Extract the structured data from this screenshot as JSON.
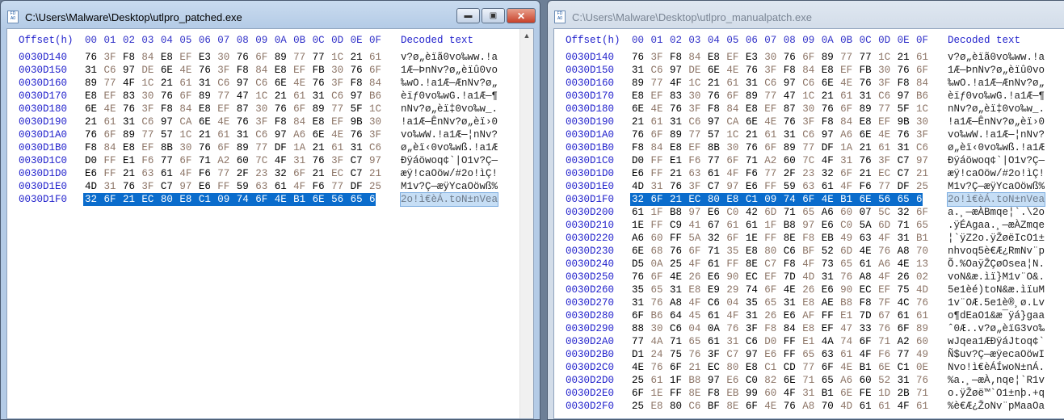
{
  "header": {
    "offset_label": "Offset(h)",
    "columns": [
      "00",
      "01",
      "02",
      "03",
      "04",
      "05",
      "06",
      "07",
      "08",
      "09",
      "0A",
      "0B",
      "0C",
      "0D",
      "0E",
      "0F"
    ],
    "decoded_label": "Decoded text"
  },
  "windows": [
    {
      "title": "C:\\Users\\Malware\\Desktop\\utlpro_patched.exe",
      "active": true,
      "selected_offset": "0030D1F0",
      "rows": [
        {
          "offset": "0030D140",
          "hex": [
            "76",
            "3F",
            "F8",
            "84",
            "E8",
            "EF",
            "E3",
            "30",
            "76",
            "6F",
            "89",
            "77",
            "77",
            "1C",
            "21",
            "61"
          ],
          "text": "v?ø„èïã0vo‰ww.!a"
        },
        {
          "offset": "0030D150",
          "hex": [
            "31",
            "C6",
            "97",
            "DE",
            "6E",
            "4E",
            "76",
            "3F",
            "F8",
            "84",
            "E8",
            "EF",
            "FB",
            "30",
            "76",
            "6F"
          ],
          "text": "1Æ—ÞnNv?ø„èïû0vo"
        },
        {
          "offset": "0030D160",
          "hex": [
            "89",
            "77",
            "4F",
            "1C",
            "21",
            "61",
            "31",
            "C6",
            "97",
            "C6",
            "6E",
            "4E",
            "76",
            "3F",
            "F8",
            "84"
          ],
          "text": "‰wO.!a1Æ—ÆnNv?ø„"
        },
        {
          "offset": "0030D170",
          "hex": [
            "E8",
            "EF",
            "83",
            "30",
            "76",
            "6F",
            "89",
            "77",
            "47",
            "1C",
            "21",
            "61",
            "31",
            "C6",
            "97",
            "B6"
          ],
          "text": "èïƒ0vo‰wG.!a1Æ—¶"
        },
        {
          "offset": "0030D180",
          "hex": [
            "6E",
            "4E",
            "76",
            "3F",
            "F8",
            "84",
            "E8",
            "EF",
            "87",
            "30",
            "76",
            "6F",
            "89",
            "77",
            "5F",
            "1C"
          ],
          "text": "nNv?ø„èï‡0vo‰w_."
        },
        {
          "offset": "0030D190",
          "hex": [
            "21",
            "61",
            "31",
            "C6",
            "97",
            "CA",
            "6E",
            "4E",
            "76",
            "3F",
            "F8",
            "84",
            "E8",
            "EF",
            "9B",
            "30"
          ],
          "text": "!a1Æ—ÊnNv?ø„èï›0"
        },
        {
          "offset": "0030D1A0",
          "hex": [
            "76",
            "6F",
            "89",
            "77",
            "57",
            "1C",
            "21",
            "61",
            "31",
            "C6",
            "97",
            "A6",
            "6E",
            "4E",
            "76",
            "3F"
          ],
          "text": "vo‰wW.!a1Æ—¦nNv?"
        },
        {
          "offset": "0030D1B0",
          "hex": [
            "F8",
            "84",
            "E8",
            "EF",
            "8B",
            "30",
            "76",
            "6F",
            "89",
            "77",
            "DF",
            "1A",
            "21",
            "61",
            "31",
            "C6"
          ],
          "text": "ø„èï‹0vo‰wß.!a1Æ"
        },
        {
          "offset": "0030D1C0",
          "hex": [
            "D0",
            "FF",
            "E1",
            "F6",
            "77",
            "6F",
            "71",
            "A2",
            "60",
            "7C",
            "4F",
            "31",
            "76",
            "3F",
            "C7",
            "97"
          ],
          "text": "Ðÿáöwoq¢`|O1v?Ç—"
        },
        {
          "offset": "0030D1D0",
          "hex": [
            "E6",
            "FF",
            "21",
            "63",
            "61",
            "4F",
            "F6",
            "77",
            "2F",
            "23",
            "32",
            "6F",
            "21",
            "EC",
            "C7",
            "21"
          ],
          "text": "æÿ!caOöw/#2o!ìÇ!"
        },
        {
          "offset": "0030D1E0",
          "hex": [
            "4D",
            "31",
            "76",
            "3F",
            "C7",
            "97",
            "E6",
            "FF",
            "59",
            "63",
            "61",
            "4F",
            "F6",
            "77",
            "DF",
            "25"
          ],
          "text": "M1v?Ç—æÿYcaOöwß%"
        },
        {
          "offset": "0030D1F0",
          "hex": [
            "32",
            "6F",
            "21",
            "EC",
            "80",
            "E8",
            "C1",
            "09",
            "74",
            "6F",
            "4E",
            "B1",
            "6E",
            "56",
            "65",
            "61"
          ],
          "text": "2o!ì€èÁ.toN±nVea"
        }
      ]
    },
    {
      "title": "C:\\Users\\Malware\\Desktop\\utlpro_manualpatch.exe",
      "active": false,
      "selected_offset": "0030D1F0",
      "rows": [
        {
          "offset": "0030D140",
          "hex": [
            "76",
            "3F",
            "F8",
            "84",
            "E8",
            "EF",
            "E3",
            "30",
            "76",
            "6F",
            "89",
            "77",
            "77",
            "1C",
            "21",
            "61"
          ],
          "text": "v?ø„èïã0vo‰ww.!a"
        },
        {
          "offset": "0030D150",
          "hex": [
            "31",
            "C6",
            "97",
            "DE",
            "6E",
            "4E",
            "76",
            "3F",
            "F8",
            "84",
            "E8",
            "EF",
            "FB",
            "30",
            "76",
            "6F"
          ],
          "text": "1Æ—ÞnNv?ø„èïû0vo"
        },
        {
          "offset": "0030D160",
          "hex": [
            "89",
            "77",
            "4F",
            "1C",
            "21",
            "61",
            "31",
            "C6",
            "97",
            "C6",
            "6E",
            "4E",
            "76",
            "3F",
            "F8",
            "84"
          ],
          "text": "‰wO.!a1Æ—ÆnNv?ø„"
        },
        {
          "offset": "0030D170",
          "hex": [
            "E8",
            "EF",
            "83",
            "30",
            "76",
            "6F",
            "89",
            "77",
            "47",
            "1C",
            "21",
            "61",
            "31",
            "C6",
            "97",
            "B6"
          ],
          "text": "èïƒ0vo‰wG.!a1Æ—¶"
        },
        {
          "offset": "0030D180",
          "hex": [
            "6E",
            "4E",
            "76",
            "3F",
            "F8",
            "84",
            "E8",
            "EF",
            "87",
            "30",
            "76",
            "6F",
            "89",
            "77",
            "5F",
            "1C"
          ],
          "text": "nNv?ø„èï‡0vo‰w_."
        },
        {
          "offset": "0030D190",
          "hex": [
            "21",
            "61",
            "31",
            "C6",
            "97",
            "CA",
            "6E",
            "4E",
            "76",
            "3F",
            "F8",
            "84",
            "E8",
            "EF",
            "9B",
            "30"
          ],
          "text": "!a1Æ—ÊnNv?ø„èï›0"
        },
        {
          "offset": "0030D1A0",
          "hex": [
            "76",
            "6F",
            "89",
            "77",
            "57",
            "1C",
            "21",
            "61",
            "31",
            "C6",
            "97",
            "A6",
            "6E",
            "4E",
            "76",
            "3F"
          ],
          "text": "vo‰wW.!a1Æ—¦nNv?"
        },
        {
          "offset": "0030D1B0",
          "hex": [
            "F8",
            "84",
            "E8",
            "EF",
            "8B",
            "30",
            "76",
            "6F",
            "89",
            "77",
            "DF",
            "1A",
            "21",
            "61",
            "31",
            "C6"
          ],
          "text": "ø„èï‹0vo‰wß.!a1Æ"
        },
        {
          "offset": "0030D1C0",
          "hex": [
            "D0",
            "FF",
            "E1",
            "F6",
            "77",
            "6F",
            "71",
            "A2",
            "60",
            "7C",
            "4F",
            "31",
            "76",
            "3F",
            "C7",
            "97"
          ],
          "text": "Ðÿáöwoq¢`|O1v?Ç—"
        },
        {
          "offset": "0030D1D0",
          "hex": [
            "E6",
            "FF",
            "21",
            "63",
            "61",
            "4F",
            "F6",
            "77",
            "2F",
            "23",
            "32",
            "6F",
            "21",
            "EC",
            "C7",
            "21"
          ],
          "text": "æÿ!caOöw/#2o!ìÇ!"
        },
        {
          "offset": "0030D1E0",
          "hex": [
            "4D",
            "31",
            "76",
            "3F",
            "C7",
            "97",
            "E6",
            "FF",
            "59",
            "63",
            "61",
            "4F",
            "F6",
            "77",
            "DF",
            "25"
          ],
          "text": "M1v?Ç—æÿYcaOöwß%"
        },
        {
          "offset": "0030D1F0",
          "hex": [
            "32",
            "6F",
            "21",
            "EC",
            "80",
            "E8",
            "C1",
            "09",
            "74",
            "6F",
            "4E",
            "B1",
            "6E",
            "56",
            "65",
            "61"
          ],
          "text": "2o!ì€èÁ.toN±nVea"
        },
        {
          "offset": "0030D200",
          "hex": [
            "61",
            "1F",
            "B8",
            "97",
            "E6",
            "C0",
            "42",
            "6D",
            "71",
            "65",
            "A6",
            "60",
            "07",
            "5C",
            "32",
            "6F"
          ],
          "text": "a.¸—æÀBmqe¦`.\\2o"
        },
        {
          "offset": "0030D210",
          "hex": [
            "1E",
            "FF",
            "C9",
            "41",
            "67",
            "61",
            "61",
            "1F",
            "B8",
            "97",
            "E6",
            "C0",
            "5A",
            "6D",
            "71",
            "65"
          ],
          "text": ".ÿÉAgaa.¸—æÀZmqe"
        },
        {
          "offset": "0030D220",
          "hex": [
            "A6",
            "60",
            "FF",
            "5A",
            "32",
            "6F",
            "1E",
            "FF",
            "8E",
            "F8",
            "EB",
            "49",
            "63",
            "4F",
            "31",
            "B1"
          ],
          "text": "¦`ÿZ2o.ÿŽøëIcO1±"
        },
        {
          "offset": "0030D230",
          "hex": [
            "6E",
            "68",
            "76",
            "6F",
            "71",
            "35",
            "E8",
            "80",
            "C6",
            "BF",
            "52",
            "6D",
            "4E",
            "76",
            "A8",
            "70"
          ],
          "text": "nhvoq5è€Æ¿RmNv¨p"
        },
        {
          "offset": "0030D240",
          "hex": [
            "D5",
            "0A",
            "25",
            "4F",
            "61",
            "FF",
            "8E",
            "C7",
            "F8",
            "4F",
            "73",
            "65",
            "61",
            "A6",
            "4E",
            "13"
          ],
          "text": "Õ.%OaÿŽÇøOsea¦N."
        },
        {
          "offset": "0030D250",
          "hex": [
            "76",
            "6F",
            "4E",
            "26",
            "E6",
            "90",
            "EC",
            "EF",
            "7D",
            "4D",
            "31",
            "76",
            "A8",
            "4F",
            "26",
            "02"
          ],
          "text": "voN&æ.ìï}M1v¨O&."
        },
        {
          "offset": "0030D260",
          "hex": [
            "35",
            "65",
            "31",
            "E8",
            "E9",
            "29",
            "74",
            "6F",
            "4E",
            "26",
            "E6",
            "90",
            "EC",
            "EF",
            "75",
            "4D"
          ],
          "text": "5e1èé)toN&æ.ìïuM"
        },
        {
          "offset": "0030D270",
          "hex": [
            "31",
            "76",
            "A8",
            "4F",
            "C6",
            "04",
            "35",
            "65",
            "31",
            "E8",
            "AE",
            "B8",
            "F8",
            "7F",
            "4C",
            "76"
          ],
          "text": "1v¨OÆ.5e1è®¸ø.Lv"
        },
        {
          "offset": "0030D280",
          "hex": [
            "6F",
            "B6",
            "64",
            "45",
            "61",
            "4F",
            "31",
            "26",
            "E6",
            "AF",
            "FF",
            "E1",
            "7D",
            "67",
            "61",
            "61"
          ],
          "text": "o¶dEaO1&æ¯ÿá}gaa"
        },
        {
          "offset": "0030D290",
          "hex": [
            "88",
            "30",
            "C6",
            "04",
            "0A",
            "76",
            "3F",
            "F8",
            "84",
            "E8",
            "EF",
            "47",
            "33",
            "76",
            "6F",
            "89"
          ],
          "text": "ˆ0Æ..v?ø„èïG3vo‰"
        },
        {
          "offset": "0030D2A0",
          "hex": [
            "77",
            "4A",
            "71",
            "65",
            "61",
            "31",
            "C6",
            "D0",
            "FF",
            "E1",
            "4A",
            "74",
            "6F",
            "71",
            "A2",
            "60"
          ],
          "text": "wJqea1ÆÐÿáJtoq¢`"
        },
        {
          "offset": "0030D2B0",
          "hex": [
            "D1",
            "24",
            "75",
            "76",
            "3F",
            "C7",
            "97",
            "E6",
            "FF",
            "65",
            "63",
            "61",
            "4F",
            "F6",
            "77",
            "49"
          ],
          "text": "Ñ$uv?Ç—æÿecaOöwI"
        },
        {
          "offset": "0030D2C0",
          "hex": [
            "4E",
            "76",
            "6F",
            "21",
            "EC",
            "80",
            "E8",
            "C1",
            "CD",
            "77",
            "6F",
            "4E",
            "B1",
            "6E",
            "C1",
            "0E"
          ],
          "text": "Nvo!ì€èÁÍwoN±nÁ."
        },
        {
          "offset": "0030D2D0",
          "hex": [
            "25",
            "61",
            "1F",
            "B8",
            "97",
            "E6",
            "C0",
            "82",
            "6E",
            "71",
            "65",
            "A6",
            "60",
            "52",
            "31",
            "76"
          ],
          "text": "%a.¸—æÀ‚nqe¦`R1v"
        },
        {
          "offset": "0030D2E0",
          "hex": [
            "6F",
            "1E",
            "FF",
            "8E",
            "F8",
            "EB",
            "99",
            "60",
            "4F",
            "31",
            "B1",
            "6E",
            "FE",
            "1D",
            "2B",
            "71"
          ],
          "text": "o.ÿŽøë™`O1±nþ.+q"
        },
        {
          "offset": "0030D2F0",
          "hex": [
            "25",
            "E8",
            "80",
            "C6",
            "BF",
            "8E",
            "6F",
            "4E",
            "76",
            "A8",
            "70",
            "4D",
            "61",
            "61",
            "4F",
            "61"
          ],
          "text": "%è€Æ¿ŽoNv¨pMaaOa"
        }
      ]
    }
  ],
  "colors": {
    "offset": "#2222cc",
    "selection": "#0a6ccc",
    "odd_column": "#8c7466"
  },
  "icons": {
    "app": "hex-editor-icon",
    "minimize": "minimize-icon",
    "maximize": "maximize-icon",
    "close": "close-icon",
    "scroll_up": "chevron-up-icon"
  }
}
